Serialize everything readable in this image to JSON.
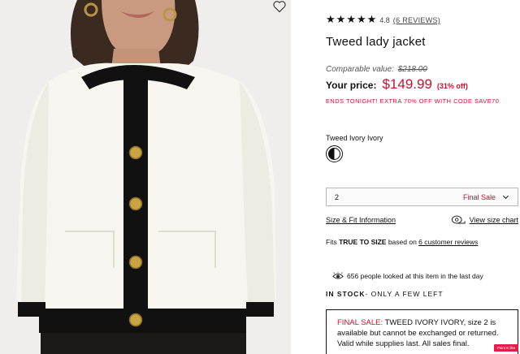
{
  "product": {
    "title": "Tweed lady jacket",
    "rating": "4.8",
    "reviews_link": "(6 REVIEWS)",
    "stars": [
      "★",
      "★",
      "★",
      "★",
      "★"
    ],
    "wishlist_icon": "heart-icon"
  },
  "pricing": {
    "comparable_label": "Comparable value:",
    "comparable_price": "$218.00",
    "your_price_label": "Your price:",
    "your_price": "$149.99",
    "discount": "(31% off)",
    "promo": "ENDS TONIGHT! EXTRA 70% OFF WITH CODE SAVE70",
    "accent_color": "#c8102e"
  },
  "color": {
    "label": "Tweed Ivory Ivory",
    "swatch_icon": "half-black-white-swatch"
  },
  "size": {
    "selected": "2",
    "tag": "Final Sale"
  },
  "links": {
    "size_fit": "Size & Fit Information",
    "size_chart": "View size chart"
  },
  "fit": {
    "prefix": "Fits ",
    "bold": "TRUE TO SIZE",
    "middle": " based on ",
    "link": "6 customer reviews"
  },
  "social": {
    "looked": "656 people looked at this item in the last day"
  },
  "stock": {
    "bold": "IN STOCK",
    "rest": "- ONLY A FEW LEFT"
  },
  "final_sale": {
    "red": "FINAL SALE:",
    "text": " TWEED IVORY IVORY, size 2 is available but cannot be exchanged or returned. Valid while supplies last. All sales final."
  },
  "badge": {
    "text": "Paint E like"
  }
}
